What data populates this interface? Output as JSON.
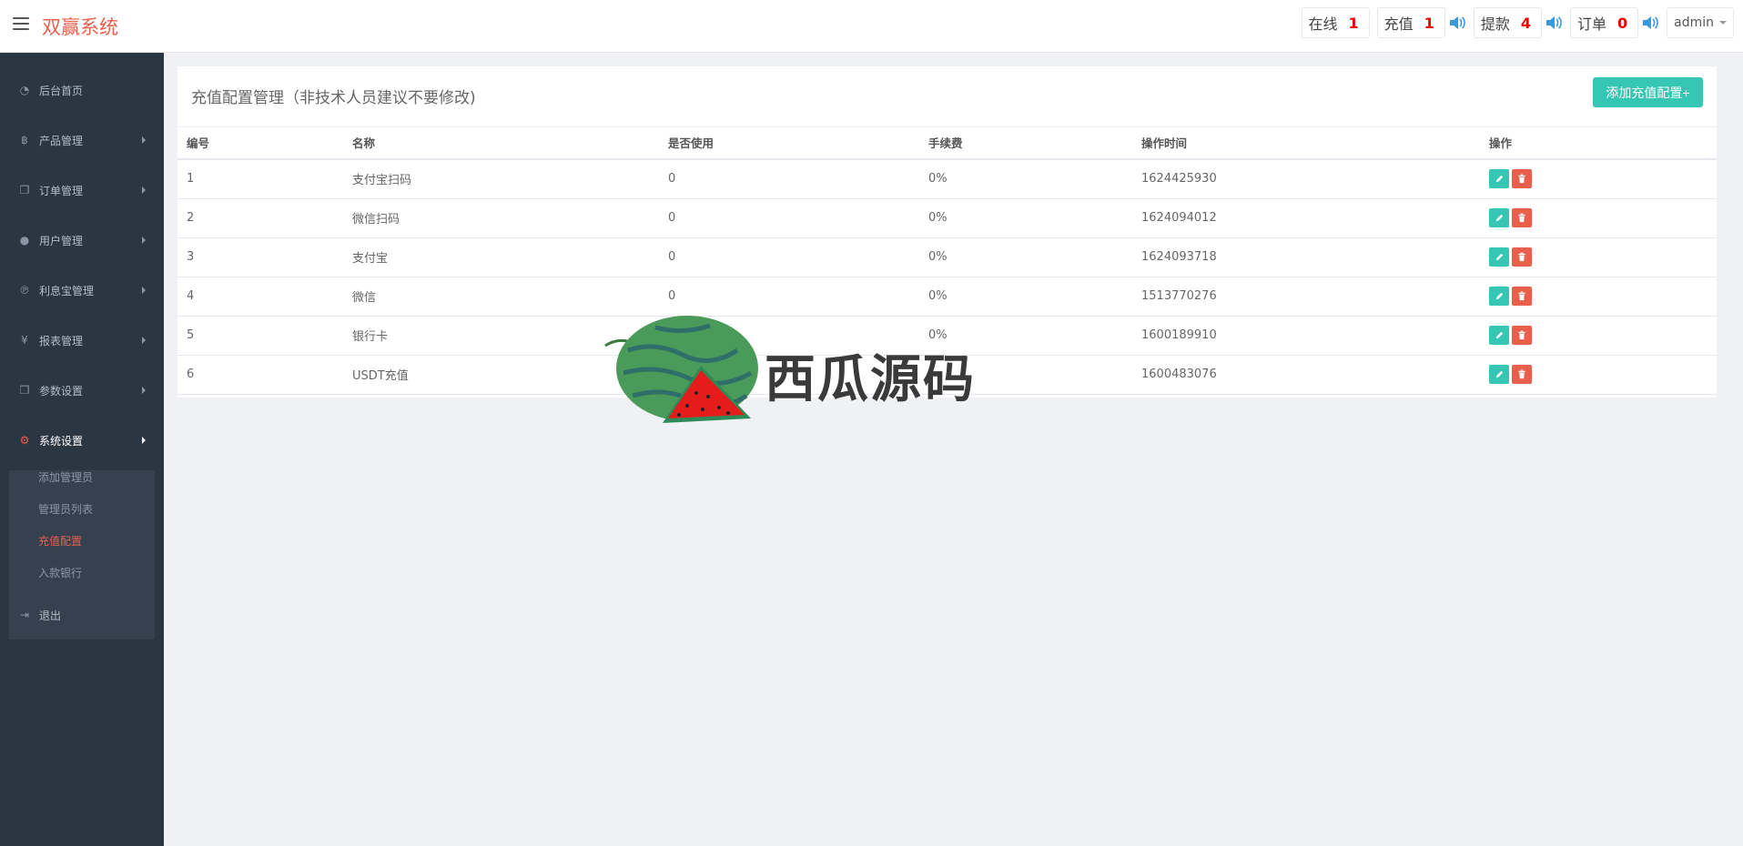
{
  "header": {
    "brand": "双赢系统",
    "stats": [
      {
        "label": "在线",
        "value": "1",
        "speaker": false
      },
      {
        "label": "充值",
        "value": "1",
        "speaker": true
      },
      {
        "label": "提款",
        "value": "4",
        "speaker": true
      },
      {
        "label": "订单",
        "value": "0",
        "speaker": true
      }
    ],
    "user": "admin"
  },
  "sidebar": {
    "items": [
      {
        "label": "后台首页",
        "icon": "dashboard-icon"
      },
      {
        "label": "产品管理",
        "icon": "bitcoin-icon"
      },
      {
        "label": "订单管理",
        "icon": "copy-icon"
      },
      {
        "label": "用户管理",
        "icon": "user-icon"
      },
      {
        "label": "利息宝管理",
        "icon": "pinterest-icon"
      },
      {
        "label": "报表管理",
        "icon": "yen-icon"
      },
      {
        "label": "参数设置",
        "icon": "copy-icon"
      },
      {
        "label": "系统设置",
        "icon": "gears-icon"
      },
      {
        "label": "退出",
        "icon": "sign-out-icon"
      }
    ],
    "system_sub": [
      "添加管理员",
      "管理员列表",
      "充值配置",
      "入款银行"
    ]
  },
  "panel": {
    "title": "充值配置管理（非技术人员建议不要修改)",
    "add_button": "添加充值配置+",
    "columns": [
      "编号",
      "名称",
      "是否使用",
      "手续费",
      "操作时间",
      "操作"
    ],
    "rows": [
      [
        "1",
        "支付宝扫码",
        "0",
        "0%",
        "1624425930"
      ],
      [
        "2",
        "微信扫码",
        "0",
        "0%",
        "1624094012"
      ],
      [
        "3",
        "支付宝",
        "0",
        "0%",
        "1624093718"
      ],
      [
        "4",
        "微信",
        "0",
        "0%",
        "1513770276"
      ],
      [
        "5",
        "银行卡",
        "",
        "0%",
        "1600189910"
      ],
      [
        "6",
        "USDT充值",
        "",
        "",
        "1600483076"
      ]
    ]
  },
  "watermark": {
    "text": "西瓜源码",
    "icon": "watermelon-icon"
  }
}
